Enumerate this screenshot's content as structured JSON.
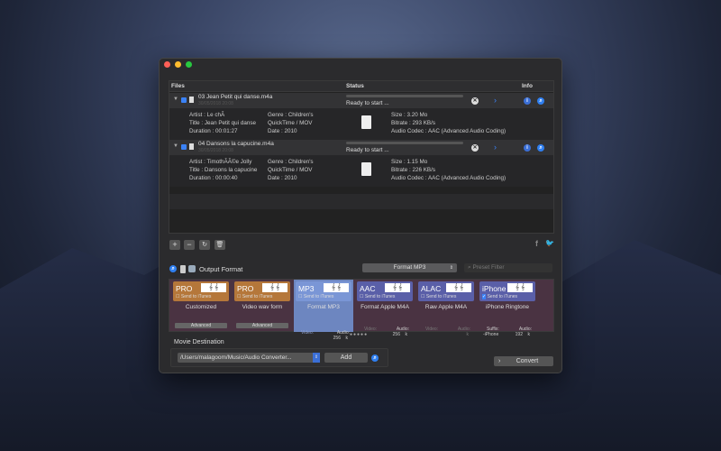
{
  "table": {
    "headers": {
      "files": "Files",
      "status": "Status",
      "info": "Info"
    },
    "files": [
      {
        "name": "03 Jean Petit qui danse.m4a",
        "date": "30/05/2018 20:08",
        "status": "Ready to start ...",
        "artist": "Artist : Le chÃ",
        "title": "Title : Jean Petit qui danse",
        "duration": "Duration : 00:01:27",
        "genre": "Genre : Children's",
        "container": "QuickTime / MOV",
        "year": "Date : 2010",
        "size": "Size : 3.20 Mo",
        "bitrate": "Bitrate : 293 KB/s",
        "codec": "Audio Codec : AAC (Advanced Audio Coding)"
      },
      {
        "name": "04 Dansons la capucine.m4a",
        "date": "30/05/2018 20:08",
        "status": "Ready to start ...",
        "artist": "Artist : TimothÃÃ©e Jolly",
        "title": "Title : Dansons la capucine",
        "duration": "Duration : 00:00:40",
        "genre": "Genre : Children's",
        "container": "QuickTime / MOV",
        "year": "Date : 2010",
        "size": "Size : 1.15 Mo",
        "bitrate": "Bitrate : 226 KB/s",
        "codec": "Audio Codec : AAC (Advanced Audio Coding)"
      }
    ]
  },
  "toolbar": {
    "add": "+",
    "remove": "−"
  },
  "output": {
    "label": "Output Format",
    "format_select": "Format MP3",
    "filter_placeholder": "Preset Filter",
    "cards": [
      {
        "tag": "PRO",
        "send": "Send to iTunes",
        "name": "Customized",
        "advanced": "Advanced",
        "color": "#b5773a"
      },
      {
        "tag": "PRO",
        "send": "Send to iTunes",
        "name": "Video wav form",
        "advanced": "Advanced",
        "color": "#b5773a"
      },
      {
        "tag": "MP3",
        "send": "Send to iTunes",
        "name": "Format MP3",
        "video": "Video:",
        "audio": "Audio:",
        "audio_val": "256",
        "unit": "k",
        "color": "#7a96d6"
      },
      {
        "tag": "AAC",
        "send": "Send to iTunes",
        "name": "Format Apple M4A",
        "video": "Video:",
        "audio": "Audio:",
        "audio_val": "256",
        "unit": "k",
        "color": "#5a5fa8"
      },
      {
        "tag": "ALAC",
        "send": "Send to iTunes",
        "name": "Raw Apple M4A",
        "video": "Video:",
        "audio": "Audio:",
        "audio_val": "",
        "unit": "k",
        "color": "#5a5fa8"
      },
      {
        "tag": "iPhone",
        "send": "Send to iTunes",
        "name": "iPhone Ringtone",
        "video": "Suffix:",
        "video_val": "-iPhone",
        "audio": "Audio:",
        "audio_val": "192",
        "unit": "k",
        "color": "#5a5fa8"
      }
    ]
  },
  "destination": {
    "label": "Movie Destination",
    "path": "/Users/malagoom/Music/Audio Converter...",
    "add": "Add"
  },
  "convert": "Convert"
}
